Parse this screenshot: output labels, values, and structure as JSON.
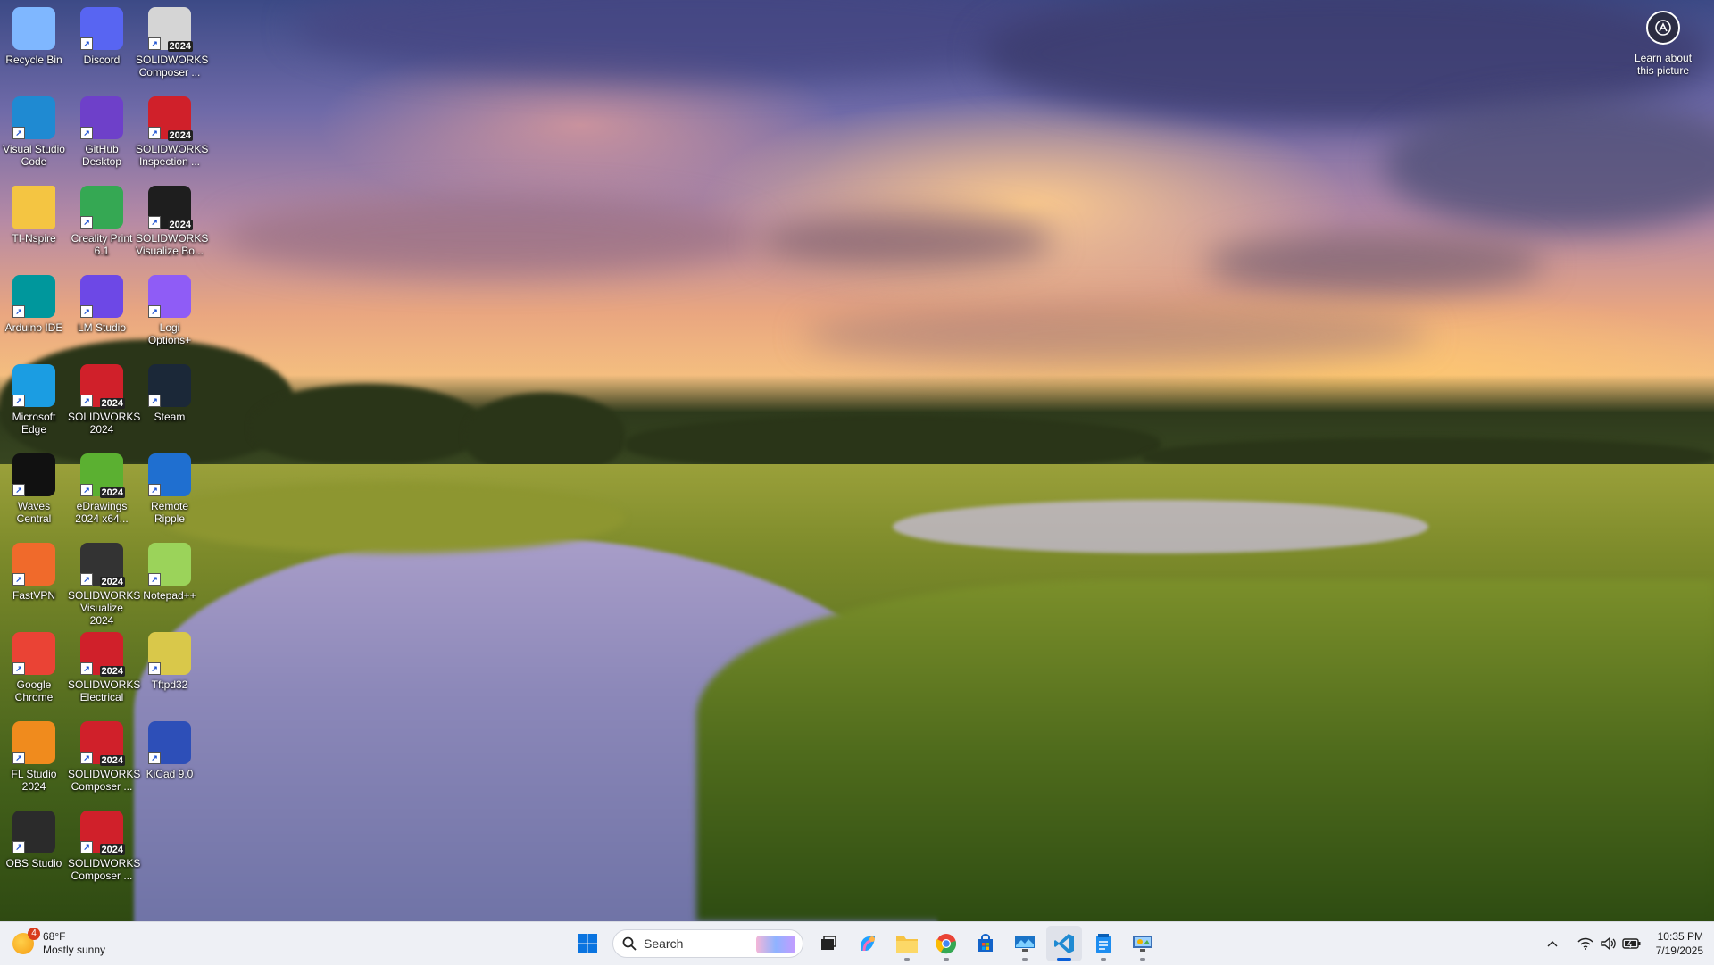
{
  "wallpaper": {
    "learn_label": "Learn about\nthis picture"
  },
  "desktop_icons": [
    {
      "label": "Recycle Bin",
      "icon": "recycle-bin-icon",
      "color": "#7fb7ff"
    },
    {
      "label": "Discord",
      "icon": "discord-icon",
      "color": "#5865f2"
    },
    {
      "label": "SOLIDWORKS\nComposer ...",
      "icon": "solidworks-composer-icon",
      "color": "#d5d5d5",
      "badge": "2024"
    },
    {
      "label": "Visual Studio\nCode",
      "icon": "vscode-icon",
      "color": "#1f8ad2"
    },
    {
      "label": "GitHub\nDesktop",
      "icon": "github-desktop-icon",
      "color": "#6e40c9"
    },
    {
      "label": "SOLIDWORKS\nInspection ...",
      "icon": "solidworks-inspection-icon",
      "color": "#d0202a",
      "badge": "2024"
    },
    {
      "label": "TI-Nspire",
      "icon": "folder-icon",
      "color": "#f4c542"
    },
    {
      "label": "Creality Print\n6.1",
      "icon": "creality-print-icon",
      "color": "#35a853"
    },
    {
      "label": "SOLIDWORKS\nVisualize Bo...",
      "icon": "solidworks-visualize-boost-icon",
      "color": "#1e1e1e",
      "badge": "2024"
    },
    {
      "label": "Arduino IDE",
      "icon": "arduino-icon",
      "color": "#00979c"
    },
    {
      "label": "LM Studio",
      "icon": "lm-studio-icon",
      "color": "#6d48e6"
    },
    {
      "label": "Logi\nOptions+",
      "icon": "logi-options-icon",
      "color": "#8f5cf6"
    },
    {
      "label": "Microsoft\nEdge",
      "icon": "edge-icon",
      "color": "#1b9de2"
    },
    {
      "label": "SOLIDWORKS\n2024",
      "icon": "solidworks-icon",
      "color": "#d0202a",
      "badge": "2024"
    },
    {
      "label": "Steam",
      "icon": "steam-icon",
      "color": "#1b2838"
    },
    {
      "label": "Waves\nCentral",
      "icon": "waves-central-icon",
      "color": "#111111"
    },
    {
      "label": "eDrawings\n2024 x64...",
      "icon": "edrawings-icon",
      "color": "#5bb031",
      "badge": "2024"
    },
    {
      "label": "Remote\nRipple",
      "icon": "remote-ripple-icon",
      "color": "#1f6fd0"
    },
    {
      "label": "FastVPN",
      "icon": "fastvpn-icon",
      "color": "#f06a2b"
    },
    {
      "label": "SOLIDWORKS\nVisualize 2024",
      "icon": "solidworks-visualize-icon",
      "color": "#333333",
      "badge": "2024"
    },
    {
      "label": "Notepad++",
      "icon": "notepad-plus-plus-icon",
      "color": "#9bd35a"
    },
    {
      "label": "Google\nChrome",
      "icon": "chrome-icon",
      "color": "#ea4335"
    },
    {
      "label": "SOLIDWORKS\nElectrical",
      "icon": "solidworks-electrical-icon",
      "color": "#d0202a",
      "badge": "2024"
    },
    {
      "label": "Tftpd32",
      "icon": "tftpd32-icon",
      "color": "#d9c84a"
    },
    {
      "label": "FL Studio\n2024",
      "icon": "fl-studio-icon",
      "color": "#f08b1d"
    },
    {
      "label": "SOLIDWORKS\nComposer ...",
      "icon": "solidworks-composer-icon",
      "color": "#d0202a",
      "badge": "2024"
    },
    {
      "label": "KiCad 9.0",
      "icon": "kicad-icon",
      "color": "#2d4fb8"
    },
    {
      "label": "OBS Studio",
      "icon": "obs-studio-icon",
      "color": "#2b2b2b"
    },
    {
      "label": "SOLIDWORKS\nComposer ...",
      "icon": "solidworks-composer-icon",
      "color": "#d0202a",
      "badge": "2024"
    }
  ],
  "taskbar": {
    "weather": {
      "badge_count": "4",
      "temperature": "68°F",
      "condition": "Mostly sunny"
    },
    "search_placeholder": "Search",
    "apps": [
      {
        "name": "start-button",
        "icon": "windows-icon"
      },
      {
        "name": "task-view-button",
        "icon": "task-view-icon"
      },
      {
        "name": "copilot-button",
        "icon": "copilot-icon"
      },
      {
        "name": "file-explorer-button",
        "icon": "folder-icon"
      },
      {
        "name": "chrome-button",
        "icon": "chrome-icon"
      },
      {
        "name": "microsoft-store-button",
        "icon": "store-icon"
      },
      {
        "name": "remote-desktop-button",
        "icon": "remote-desktop-icon"
      },
      {
        "name": "vscode-button",
        "icon": "vscode-icon",
        "active": true
      },
      {
        "name": "notepad-button",
        "icon": "notepad-icon"
      },
      {
        "name": "control-panel-button",
        "icon": "control-panel-icon"
      }
    ],
    "clock": {
      "time": "10:35 PM",
      "date": "7/19/2025"
    }
  }
}
